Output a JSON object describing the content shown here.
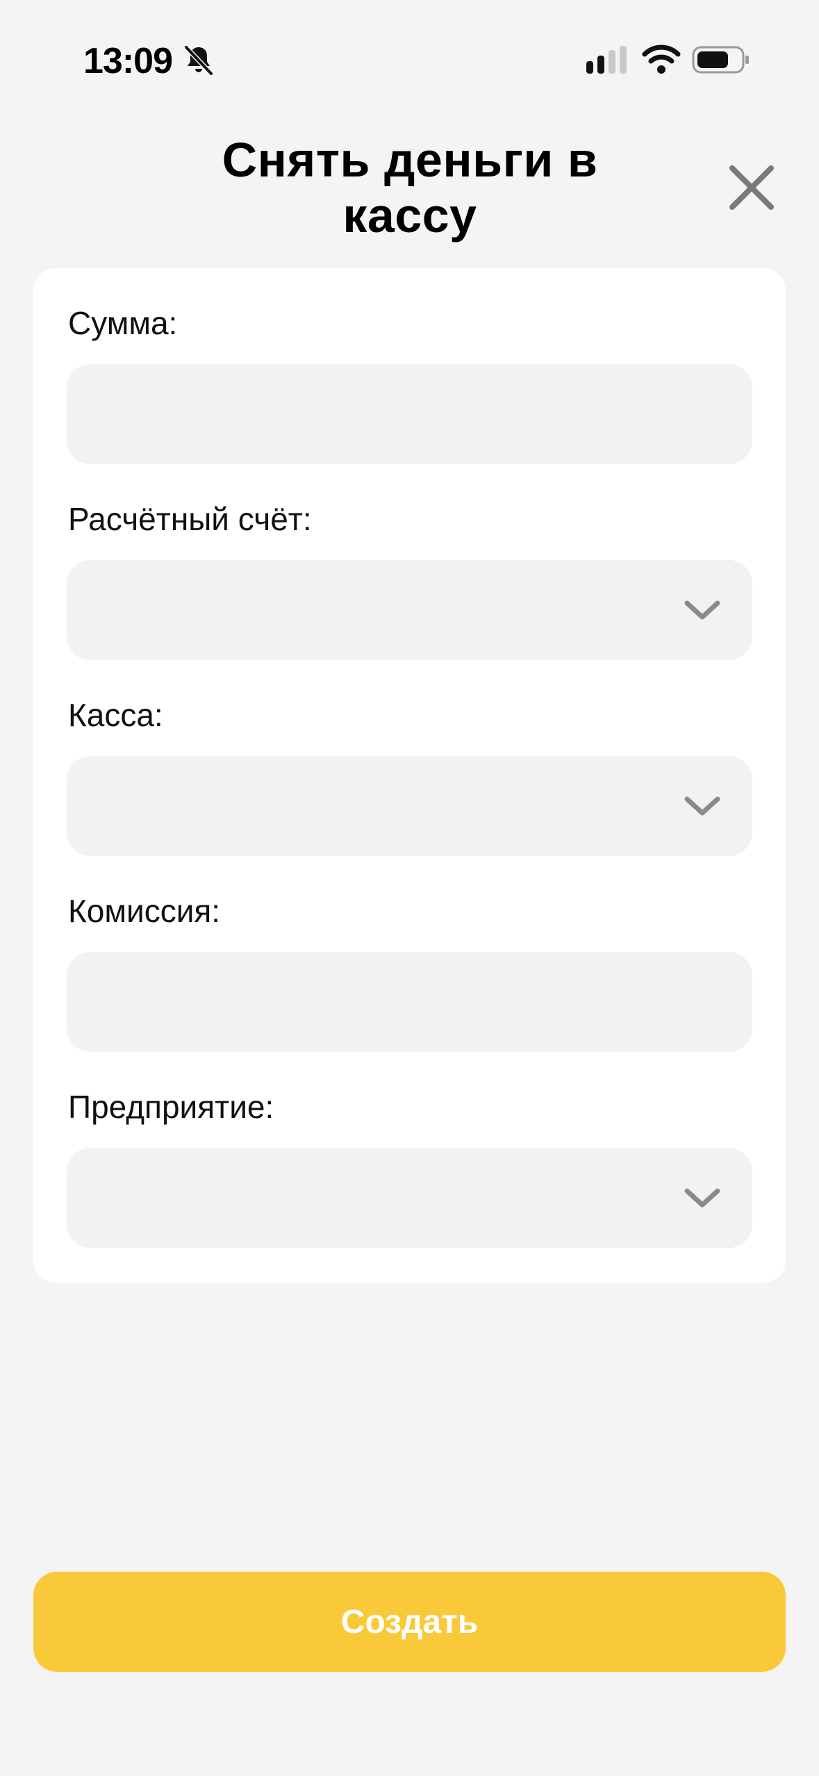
{
  "status_bar": {
    "time": "13:09",
    "icons": [
      "bell-slash-icon",
      "signal-icon",
      "wifi-icon",
      "battery-icon"
    ]
  },
  "header": {
    "title": "Снять деньги в кассу",
    "close_icon": "close-icon"
  },
  "form": {
    "fields": [
      {
        "label": "Сумма:",
        "type": "text",
        "value": ""
      },
      {
        "label": "Расчётный счёт:",
        "type": "select",
        "value": ""
      },
      {
        "label": "Касса:",
        "type": "select",
        "value": ""
      },
      {
        "label": "Комиссия:",
        "type": "text",
        "value": ""
      },
      {
        "label": "Предприятие:",
        "type": "select",
        "value": ""
      }
    ]
  },
  "actions": {
    "create_label": "Создать"
  },
  "colors": {
    "background": "#f4f4f5",
    "card": "#ffffff",
    "field": "#f1f2f4",
    "accent": "#fac93a",
    "icon": "#7a7a7a"
  }
}
